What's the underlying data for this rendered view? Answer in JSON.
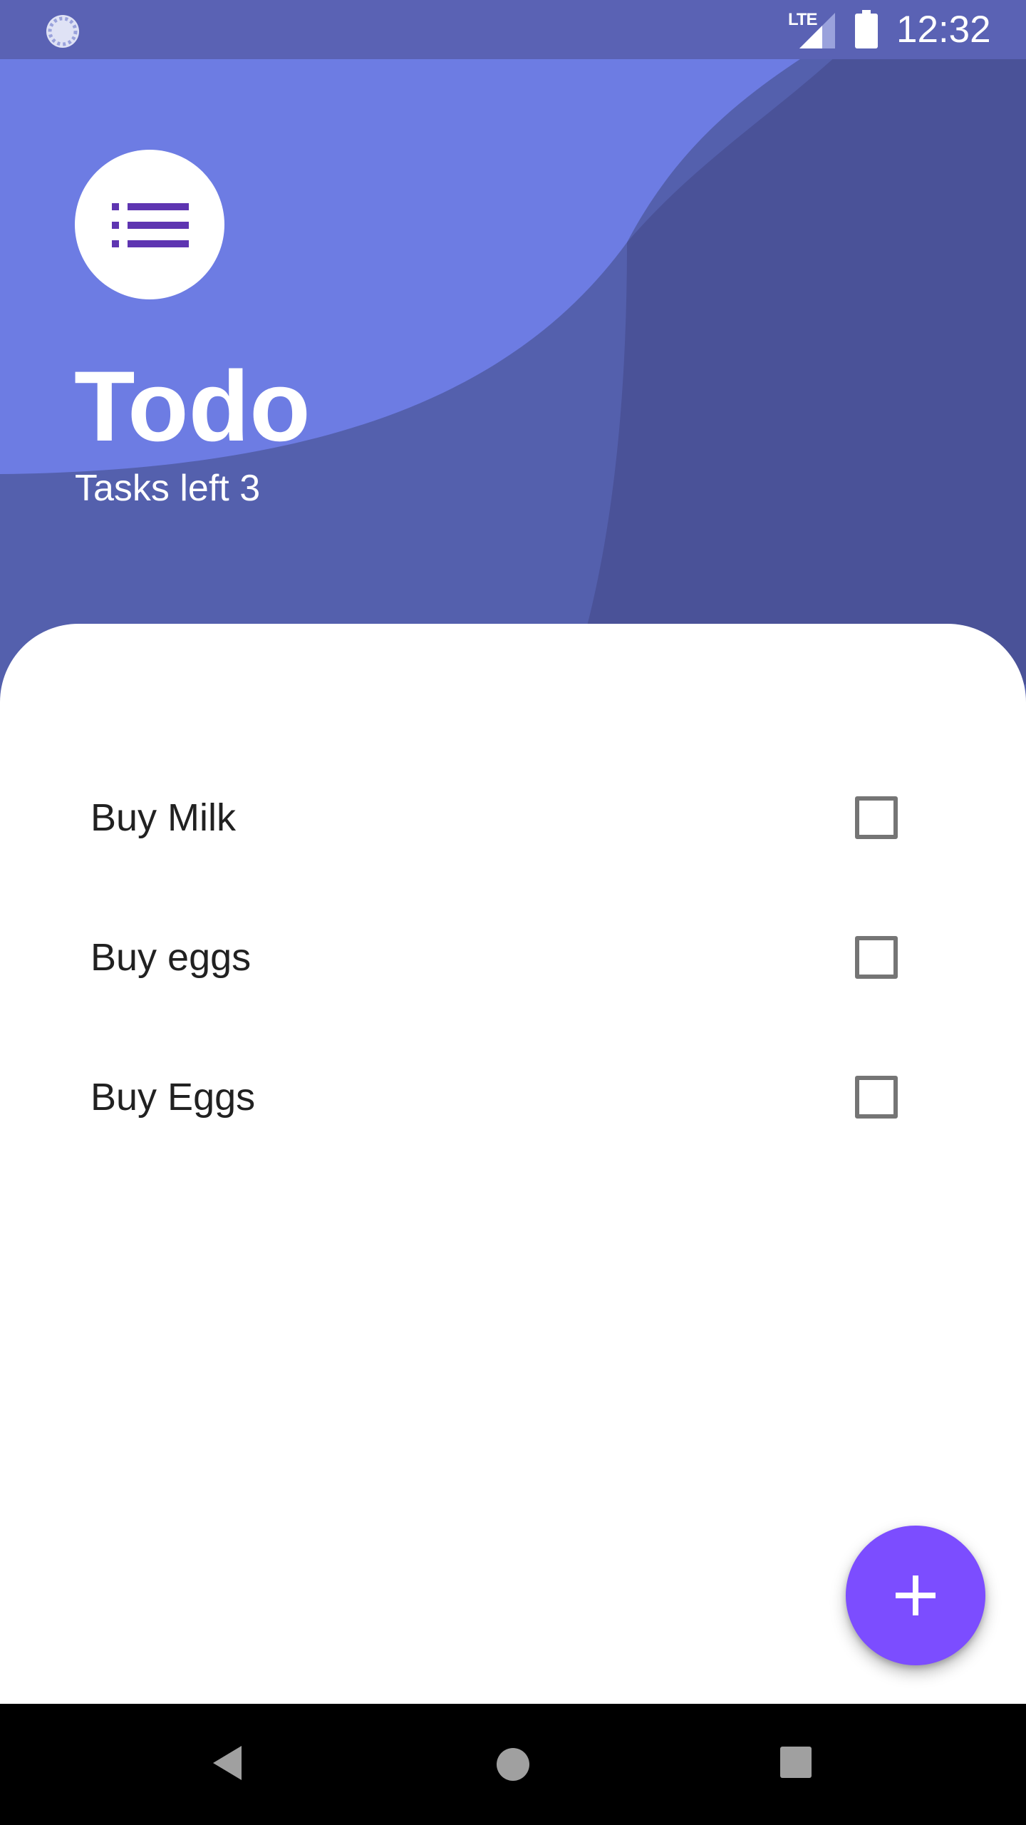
{
  "status_bar": {
    "network": "LTE",
    "time": "12:32"
  },
  "header": {
    "title": "Todo",
    "tasks_left_label": "Tasks left",
    "tasks_left_count": "3"
  },
  "tasks": [
    {
      "label": "Buy Milk",
      "checked": false
    },
    {
      "label": "Buy eggs",
      "checked": false
    },
    {
      "label": "Buy Eggs",
      "checked": false
    }
  ],
  "fab": {
    "icon": "plus-icon"
  },
  "navigation": {
    "icons": [
      "back-icon",
      "home-icon",
      "recents-icon"
    ]
  },
  "colors": {
    "header_dark": "#4a5298",
    "header_mid": "#5460ad",
    "header_light": "#6d7ce3",
    "logo_icon": "#5e35b1",
    "fab": "#7c4dff",
    "checkbox_border": "#757575",
    "task_text": "#212121"
  }
}
